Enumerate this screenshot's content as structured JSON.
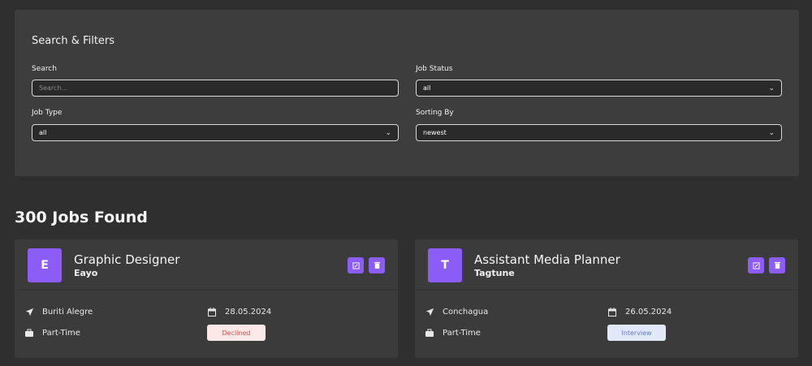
{
  "filters": {
    "title": "Search & Filters",
    "search_label": "Search",
    "search_placeholder": "Search...",
    "status_label": "Job Status",
    "status_value": "all",
    "type_label": "Job Type",
    "type_value": "all",
    "sort_label": "Sorting By",
    "sort_value": "newest"
  },
  "jobs_found": "300 Jobs Found",
  "jobs": [
    {
      "initial": "E",
      "position": "Graphic Designer",
      "company": "Eayo",
      "location": "Buriti Alegre",
      "date": "28.05.2024",
      "type": "Part-Time",
      "status": "Declined",
      "status_bg": "#fde8e8",
      "status_color": "#d9534f"
    },
    {
      "initial": "T",
      "position": "Assistant Media Planner",
      "company": "Tagtune",
      "location": "Conchagua",
      "date": "26.05.2024",
      "type": "Part-Time",
      "status": "Interview",
      "status_bg": "#e0e8f9",
      "status_color": "#647acb"
    }
  ],
  "colors": {
    "accent": "#8b5cf6",
    "background": "#2f2f2f",
    "panel": "#3d3d3d"
  }
}
